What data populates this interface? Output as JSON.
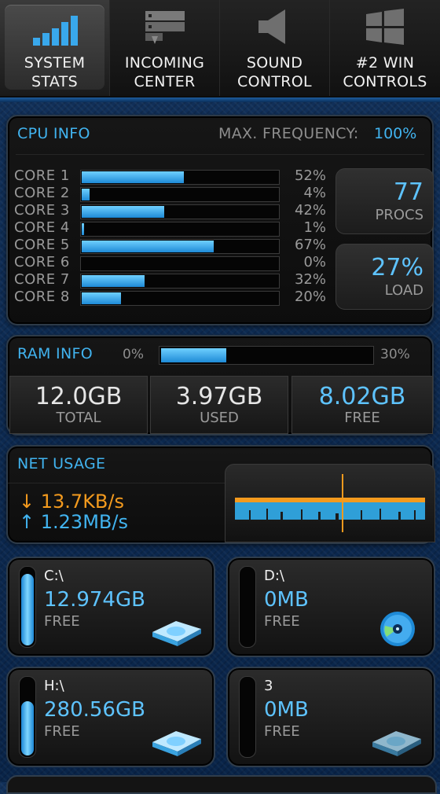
{
  "nav": {
    "tabs": [
      {
        "label": "SYSTEM\nSTATS",
        "icon": "signal-bars-icon",
        "active": true
      },
      {
        "label": "INCOMING\nCENTER",
        "icon": "server-icon",
        "active": false
      },
      {
        "label": "SOUND\nCONTROL",
        "icon": "speaker-icon",
        "active": false
      },
      {
        "label": "#2 WIN\nCONTROLS",
        "icon": "windows-logo-icon",
        "active": false
      }
    ]
  },
  "cpu": {
    "title": "CPU INFO",
    "max_freq_label": "MAX. FREQUENCY:",
    "max_freq_value": "100%",
    "cores": [
      {
        "name": "CORE 1",
        "pct_text": "52%",
        "pct": 52
      },
      {
        "name": "CORE 2",
        "pct_text": "4%",
        "pct": 4
      },
      {
        "name": "CORE 3",
        "pct_text": "42%",
        "pct": 42
      },
      {
        "name": "CORE 4",
        "pct_text": "1%",
        "pct": 1
      },
      {
        "name": "CORE 5",
        "pct_text": "67%",
        "pct": 67
      },
      {
        "name": "CORE 6",
        "pct_text": "0%",
        "pct": 0
      },
      {
        "name": "CORE 7",
        "pct_text": "32%",
        "pct": 32
      },
      {
        "name": "CORE 8",
        "pct_text": "20%",
        "pct": 20
      }
    ],
    "procs_value": "77",
    "procs_label": "PROCS",
    "load_value": "27%",
    "load_label": "LOAD"
  },
  "ram": {
    "title": "RAM INFO",
    "min_label": "0%",
    "max_label": "30%",
    "usage_fraction": 0.31,
    "total_value": "12.0GB",
    "total_label": "TOTAL",
    "used_value": "3.97GB",
    "used_label": "USED",
    "free_value": "8.02GB",
    "free_label": "FREE"
  },
  "net": {
    "title": "NET USAGE",
    "download": "13.7KB/s",
    "upload": "1.23MB/s",
    "download_color": "#f39a1e",
    "upload_color": "#41b3ef"
  },
  "drives": [
    {
      "name": "C:\\",
      "value": "12.974GB",
      "label": "FREE",
      "fill": 0.95,
      "icon": "hard-drive-icon"
    },
    {
      "name": "D:\\",
      "value": "0MB",
      "label": "FREE",
      "fill": 0.0,
      "icon": "cd-disc-icon"
    },
    {
      "name": "H:\\",
      "value": "280.56GB",
      "label": "FREE",
      "fill": 0.72,
      "icon": "hard-drive-icon"
    },
    {
      "name": "3",
      "value": "0MB",
      "label": "FREE",
      "fill": 0.0,
      "icon": "hard-drive-icon"
    }
  ],
  "colors": {
    "accent": "#41b3ef",
    "value_blue": "#5ec3ff",
    "orange": "#f39a1e",
    "panel_border": "#2d3a48",
    "background": "#0a2a55"
  }
}
